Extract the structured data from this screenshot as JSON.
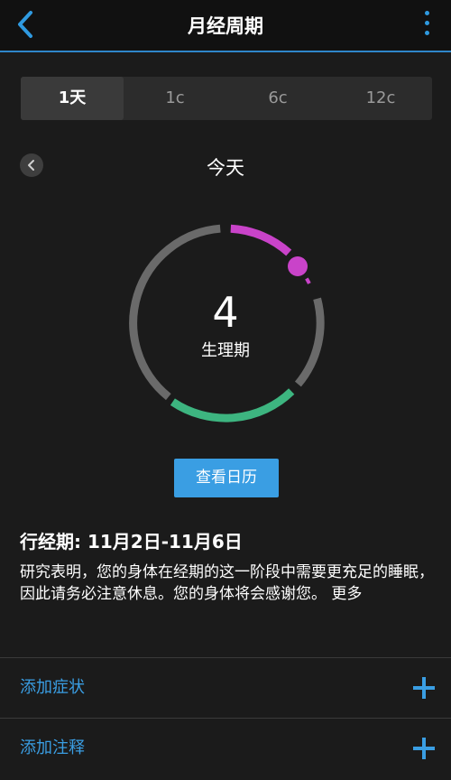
{
  "header": {
    "title": "月经周期"
  },
  "tabs": [
    {
      "label": "1天",
      "active": true
    },
    {
      "label": "1c",
      "active": false
    },
    {
      "label": "6c",
      "active": false
    },
    {
      "label": "12c",
      "active": false
    }
  ],
  "day": {
    "label": "今天"
  },
  "ring": {
    "day_number": "4",
    "phase_label": "生理期"
  },
  "calendar_button": {
    "label": "查看日历"
  },
  "period": {
    "title": "行经期: 11月2日-11月6日",
    "description": "研究表明，您的身体在经期的这一阶段中需要更充足的睡眠，因此请务必注意休息。您的身体将会感谢您。",
    "more": "更多"
  },
  "actions": {
    "add_symptom": "添加症状",
    "add_note": "添加注释"
  },
  "colors": {
    "accent": "#3a9ee3",
    "period": "#c943c9",
    "fertile": "#3db580",
    "ring_track": "#6a6a6a"
  }
}
